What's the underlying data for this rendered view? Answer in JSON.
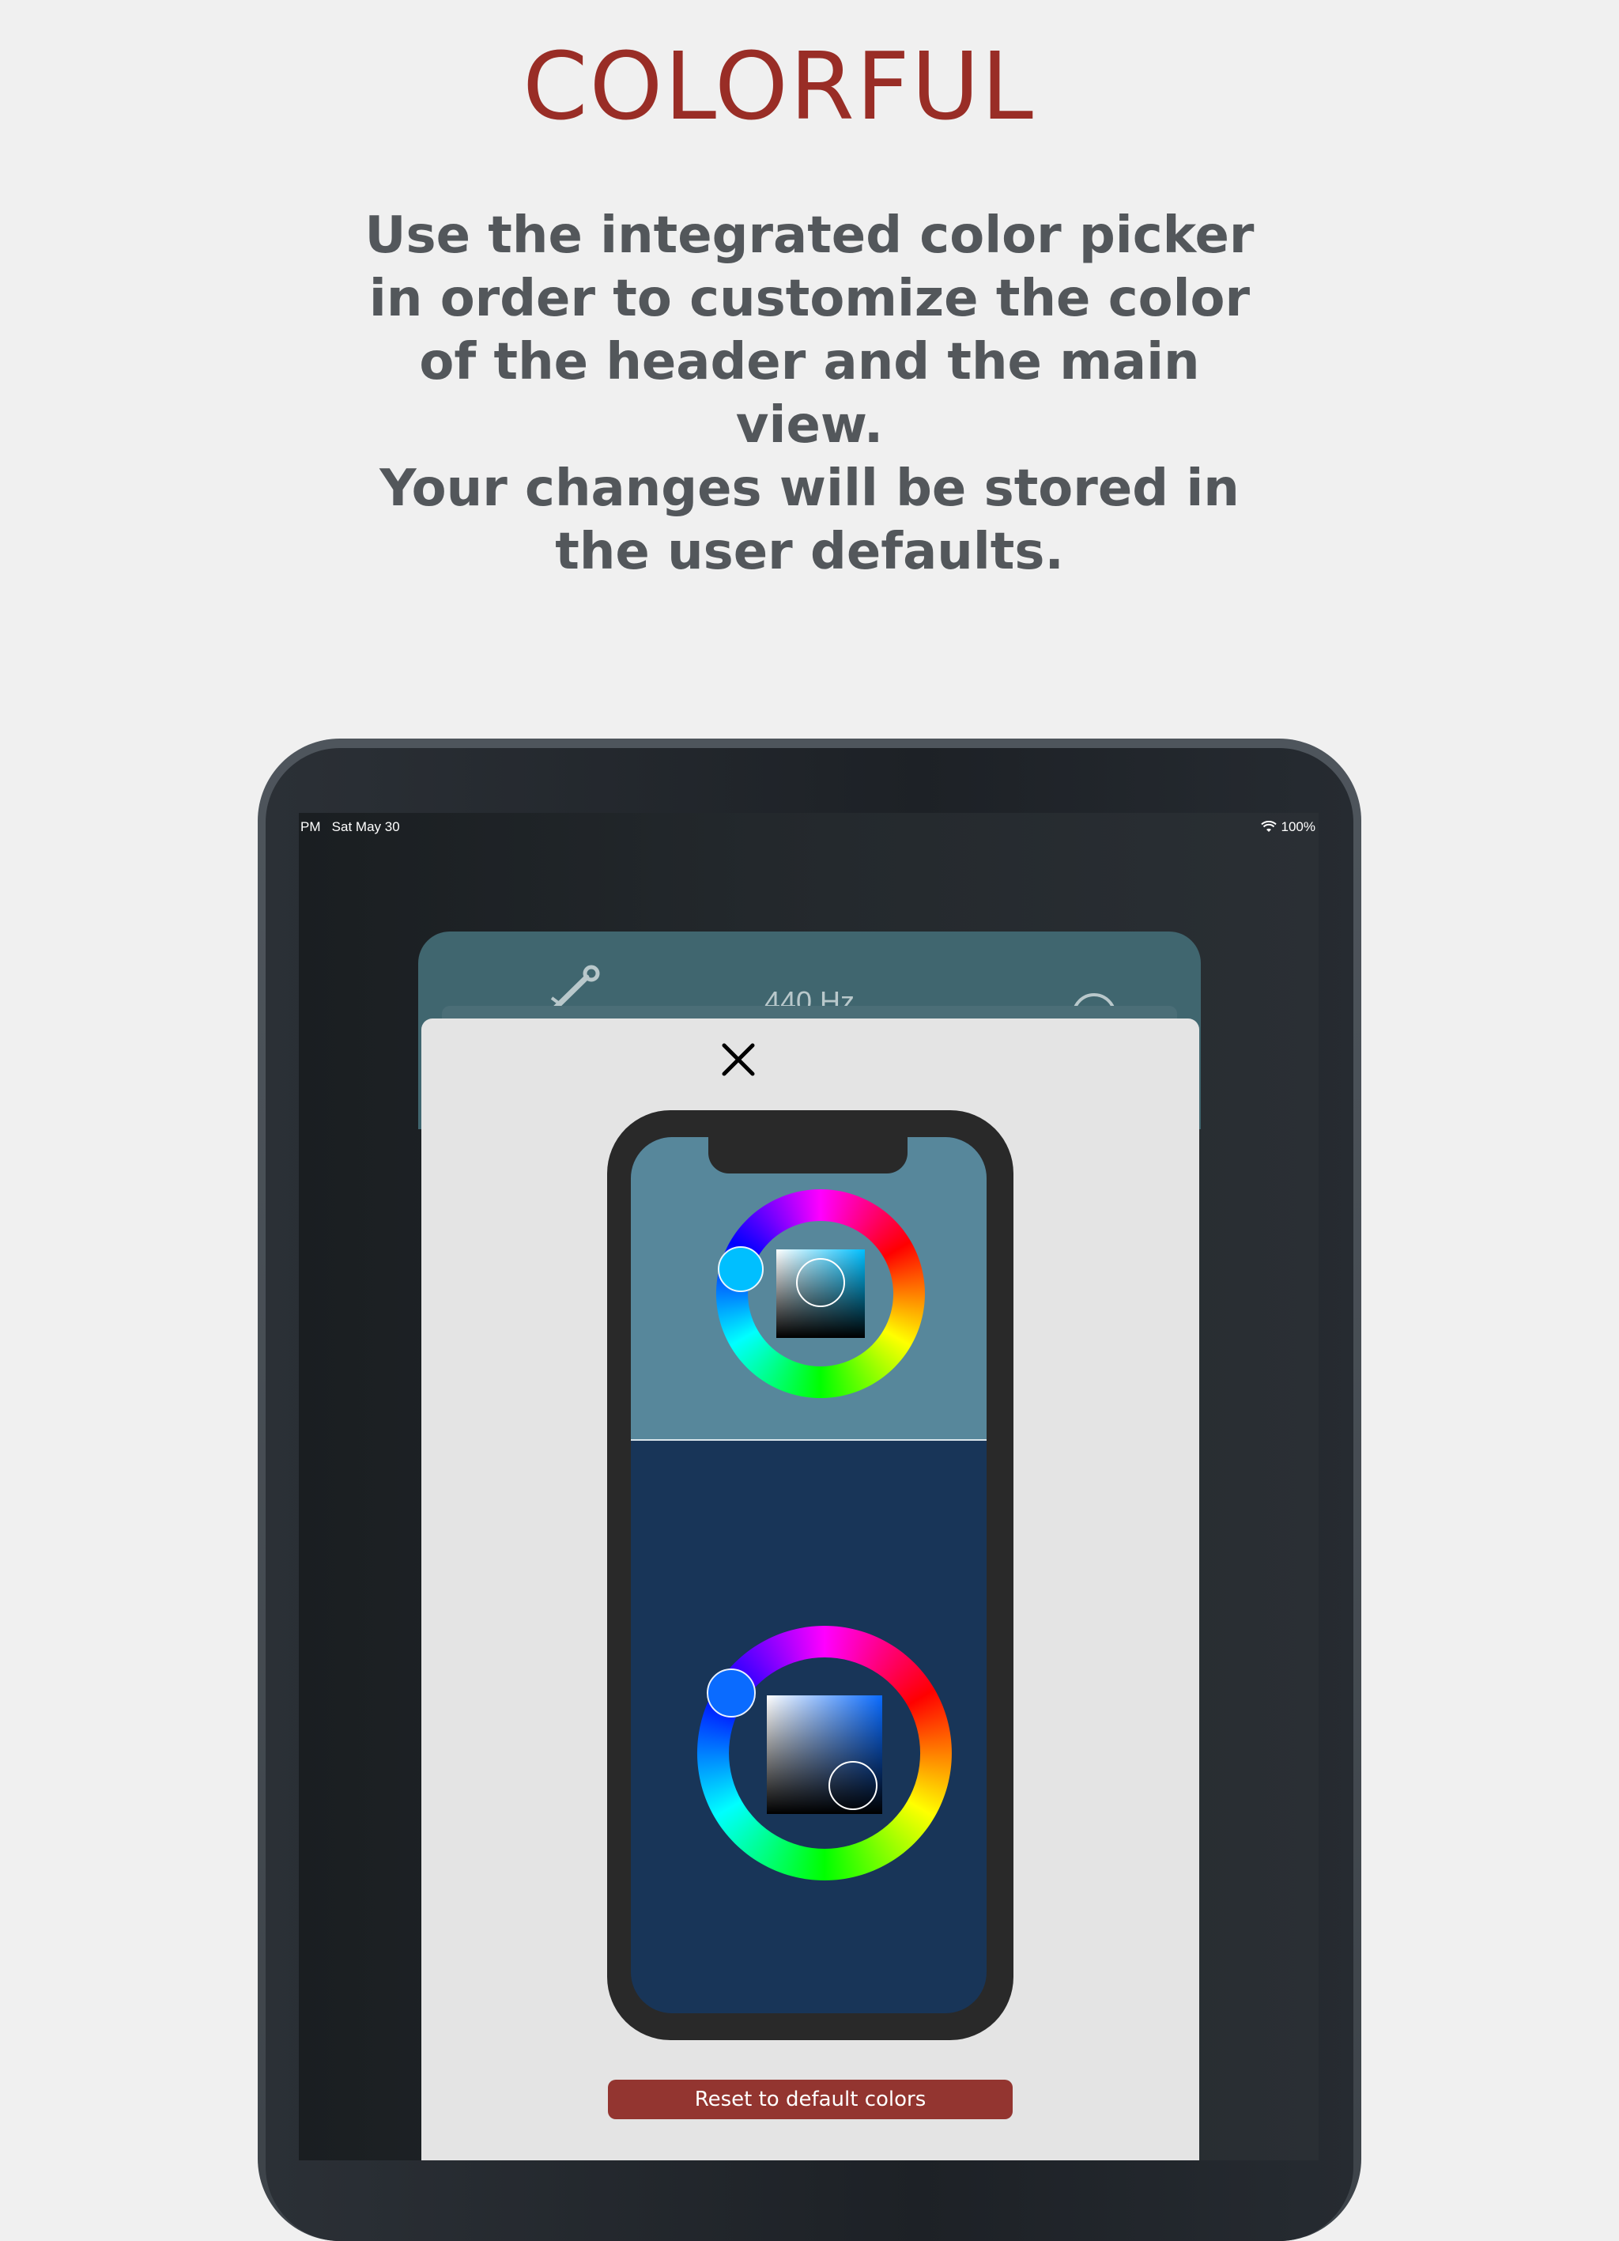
{
  "headline": "COLORFUL",
  "subtitle": "Use the integrated color picker\nin order to customize the color\nof the header and the main\nview.\nYour changes will be stored in\nthe user defaults.",
  "status_bar": {
    "time": "PM   Sat May 30",
    "battery": "100%",
    "wifi_icon": "wifi-icon"
  },
  "background_app": {
    "frequency": "440 Hz",
    "left_icon": "tuning-fork-icon",
    "right_icon": "info-icon"
  },
  "sheet": {
    "close_icon": "close-icon",
    "reset_label": "Reset to default colors"
  },
  "colors": {
    "headline": "#992d26",
    "subtitle": "#53575b",
    "header_color": "#57879b",
    "main_color": "#183558",
    "reset_button": "#933530",
    "header_hue_handle": "#00bfff",
    "main_hue_handle": "#0a6bff"
  }
}
